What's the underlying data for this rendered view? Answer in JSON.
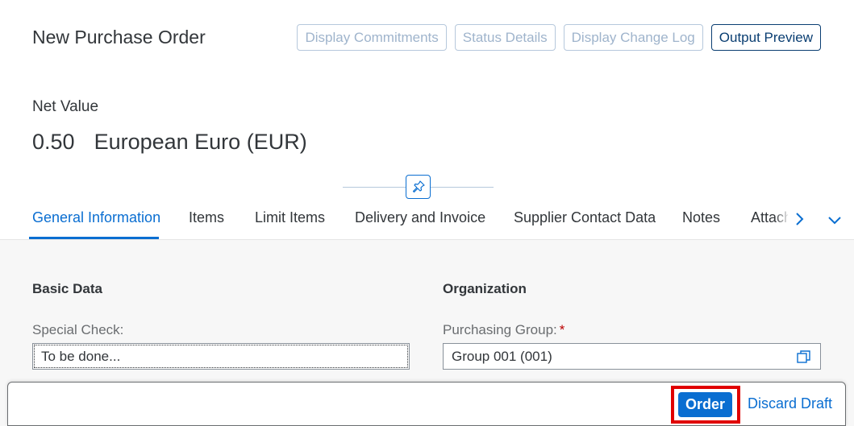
{
  "header": {
    "title": "New Purchase Order",
    "actions": [
      {
        "label": "Display Commitments"
      },
      {
        "label": "Status Details"
      },
      {
        "label": "Display Change Log"
      },
      {
        "label": "Output Preview"
      }
    ]
  },
  "kpi": {
    "label": "Net Value",
    "amount": "0.50",
    "currency": "European Euro (EUR)"
  },
  "tabs": [
    {
      "label": "General Information",
      "selected": true
    },
    {
      "label": "Items"
    },
    {
      "label": "Limit Items"
    },
    {
      "label": "Delivery and Invoice"
    },
    {
      "label": "Supplier Contact Data"
    },
    {
      "label": "Notes"
    },
    {
      "label": "Attachments"
    }
  ],
  "basic_data": {
    "title": "Basic Data",
    "special_check_label": "Special Check:",
    "special_check_value": "To be done..."
  },
  "organization": {
    "title": "Organization",
    "purchasing_group_label": "Purchasing Group:",
    "required_marker": "*",
    "purchasing_group_value": "Group 001 (001)"
  },
  "footer": {
    "order_label": "Order",
    "discard_label": "Discard Draft"
  },
  "icons": {
    "pin": "pin-icon",
    "next": "chevron-right-icon",
    "overflow": "chevron-down-icon",
    "value_help": "value-help-icon"
  },
  "colors": {
    "accent": "#0a6ed1",
    "highlight": "#e00000",
    "required": "#bb0000"
  }
}
